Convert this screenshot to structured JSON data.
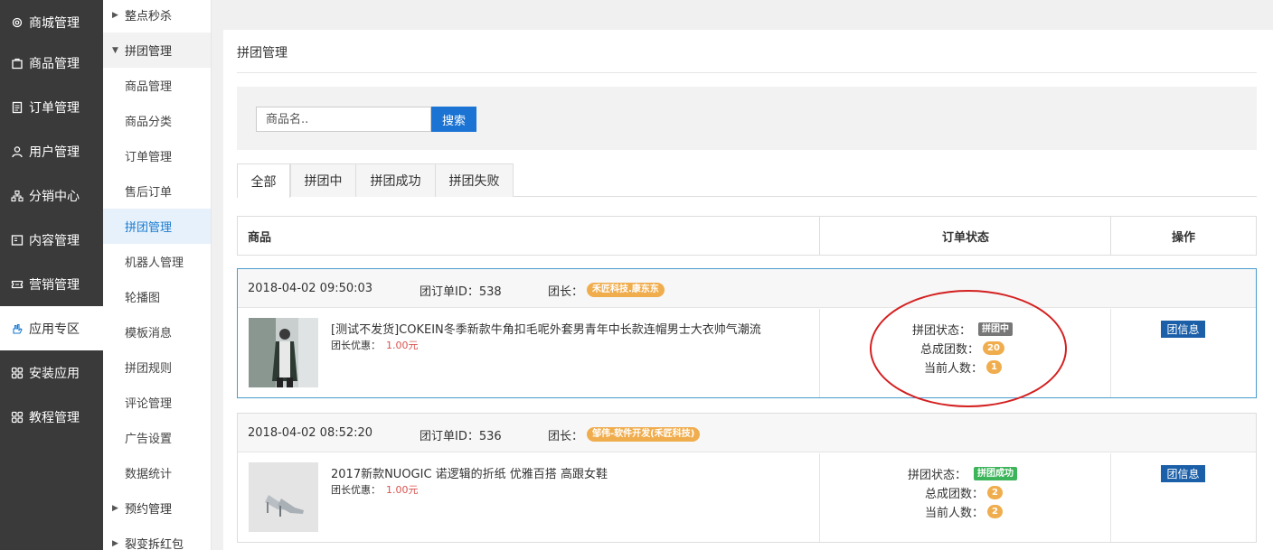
{
  "nav": {
    "items": [
      {
        "label": "商城管理",
        "icon": "gear-icon"
      },
      {
        "label": "商品管理",
        "icon": "bag-icon"
      },
      {
        "label": "订单管理",
        "icon": "clipboard-icon"
      },
      {
        "label": "用户管理",
        "icon": "user-icon"
      },
      {
        "label": "分销中心",
        "icon": "network-icon"
      },
      {
        "label": "内容管理",
        "icon": "content-icon"
      },
      {
        "label": "营销管理",
        "icon": "ticket-icon"
      },
      {
        "label": "应用专区",
        "icon": "hand-icon"
      },
      {
        "label": "安装应用",
        "icon": "grid-icon"
      },
      {
        "label": "教程管理",
        "icon": "grid-icon"
      }
    ]
  },
  "submenu": {
    "items": [
      {
        "label": "整点秒杀",
        "group": true
      },
      {
        "label": "拼团管理",
        "group": true,
        "open": true
      },
      {
        "label": "商品管理"
      },
      {
        "label": "商品分类"
      },
      {
        "label": "订单管理"
      },
      {
        "label": "售后订单"
      },
      {
        "label": "拼团管理",
        "active": true
      },
      {
        "label": "机器人管理"
      },
      {
        "label": "轮播图"
      },
      {
        "label": "模板消息"
      },
      {
        "label": "拼团规则"
      },
      {
        "label": "评论管理"
      },
      {
        "label": "广告设置"
      },
      {
        "label": "数据统计"
      },
      {
        "label": "预约管理",
        "group": true
      },
      {
        "label": "裂变拆红包",
        "group": true
      }
    ]
  },
  "main": {
    "title": "拼团管理",
    "search": {
      "placeholder": "商品名..",
      "value": "",
      "button": "搜索"
    },
    "tabs": [
      "全部",
      "拼团中",
      "拼团成功",
      "拼团失败"
    ],
    "columns": [
      "商品",
      "订单状态",
      "操作"
    ]
  },
  "orders": [
    {
      "time": "2018-04-02 09:50:03",
      "group_id_label": "团订单ID：538",
      "leader_label": "团长：",
      "leader": "禾匠科技.康东东",
      "product": "[测试不发货]COKEIN冬季新款牛角扣毛呢外套男青年中长款连帽男士大衣帅气潮流",
      "discount_label": "团长优惠：",
      "discount": "1.00元",
      "status_label": "拼团状态：",
      "status": "拼团中",
      "total_label": "总成团数：",
      "total": "20",
      "current_label": "当前人数：",
      "current": "1",
      "action": "团信息"
    },
    {
      "time": "2018-04-02 08:52:20",
      "group_id_label": "团订单ID：536",
      "leader_label": "团长：",
      "leader": "邹伟-软件开发(禾匠科技)",
      "product": "2017新款NUOGIC 诺逻辑的折纸 优雅百搭 高跟女鞋",
      "discount_label": "团长优惠：",
      "discount": "1.00元",
      "status_label": "拼团状态：",
      "status": "拼团成功",
      "total_label": "总成团数：",
      "total": "2",
      "current_label": "当前人数：",
      "current": "2",
      "action": "团信息"
    }
  ],
  "colors": {
    "nav_bg": "#3a3a3a",
    "accent_blue": "#1b73d3",
    "highlight_border": "#4a9bcf",
    "orange_badge": "#f0ad4e",
    "status_gray": "#777777",
    "status_green": "#3cb45a",
    "price_red": "#d9534f",
    "annotation_red": "#d42020"
  }
}
